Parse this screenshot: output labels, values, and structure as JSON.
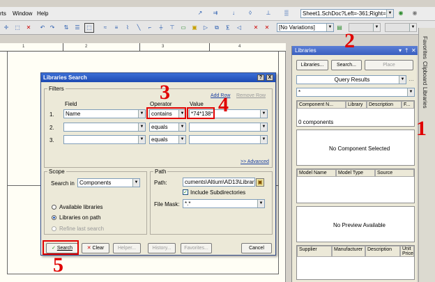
{
  "menu": {
    "items": [
      "rts",
      "Window",
      "Help"
    ]
  },
  "toolbar": {
    "sheet_combo": "Sheet1.SchDoc?Left=-361;Right=130",
    "variations_combo": "[No Variations]"
  },
  "ruler": {
    "labels": [
      "1",
      "2",
      "3",
      "4"
    ]
  },
  "dialog": {
    "title": "Libraries Search",
    "help_btn": "?",
    "close_btn": "X",
    "filters": {
      "label": "Filters",
      "add_row": "Add Row",
      "remove_row": "Remove Row",
      "col_field": "Field",
      "col_operator": "Operator",
      "col_value": "Value",
      "rows": [
        {
          "num": "1.",
          "field": "Name",
          "operator": "contains",
          "value": "*74*138*"
        },
        {
          "num": "2.",
          "field": "",
          "operator": "equals",
          "value": ""
        },
        {
          "num": "3.",
          "field": "",
          "operator": "equals",
          "value": ""
        }
      ],
      "advanced": ">> Advanced"
    },
    "scope": {
      "label": "Scope",
      "search_in_label": "Search in",
      "search_in_value": "Components",
      "opt_available": "Available libraries",
      "opt_path": "Libraries on path",
      "opt_refine": "Refine last search"
    },
    "path": {
      "label": "Path",
      "path_label": "Path:",
      "path_value": "cuments\\Altium\\AD13\\Library",
      "include_sub": "Include Subdirectories",
      "file_mask_label": "File Mask:",
      "file_mask_value": "*.*"
    },
    "buttons": {
      "search": "Search",
      "clear": "Clear",
      "helper": "Helper...",
      "history": "History...",
      "favorites": "Favorites...",
      "cancel": "Cancel"
    }
  },
  "libraries_panel": {
    "title": "Libraries",
    "libraries_btn": "Libraries...",
    "search_btn": "Search...",
    "place_btn": "Place",
    "results_combo": "Query Results",
    "filter_value": "*",
    "component_columns": [
      "Component N...",
      "Library",
      "Description",
      "F..."
    ],
    "components_count": "0 components",
    "no_component": "No Component Selected",
    "model_columns": [
      "Model Name",
      "Model Type",
      "Source"
    ],
    "no_preview": "No Preview Available",
    "supplier_columns": [
      "Supplier",
      "Manufacturer",
      "Description",
      "Unit Price"
    ]
  },
  "side_tabs": [
    "Favorites",
    "Clipboard",
    "Libraries"
  ],
  "callouts": [
    "1",
    "2",
    "3",
    "4",
    "5"
  ],
  "colors": {
    "callout": "#e00000",
    "titlebar": "#1d4ab3"
  }
}
